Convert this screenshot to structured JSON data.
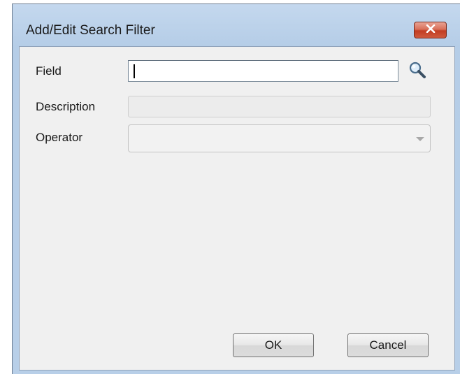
{
  "window": {
    "title": "Add/Edit Search Filter",
    "close_icon": "close-icon"
  },
  "form": {
    "field": {
      "label": "Field",
      "value": "",
      "search_icon": "magnifier-icon"
    },
    "description": {
      "label": "Description",
      "value": ""
    },
    "operator": {
      "label": "Operator",
      "selected": "",
      "icon": "chevron-down-icon"
    }
  },
  "buttons": {
    "ok_label": "OK",
    "cancel_label": "Cancel"
  },
  "colors": {
    "close_button": "#c94a2f",
    "frame": "#b8cfe8",
    "client_bg": "#f0f0f0"
  }
}
